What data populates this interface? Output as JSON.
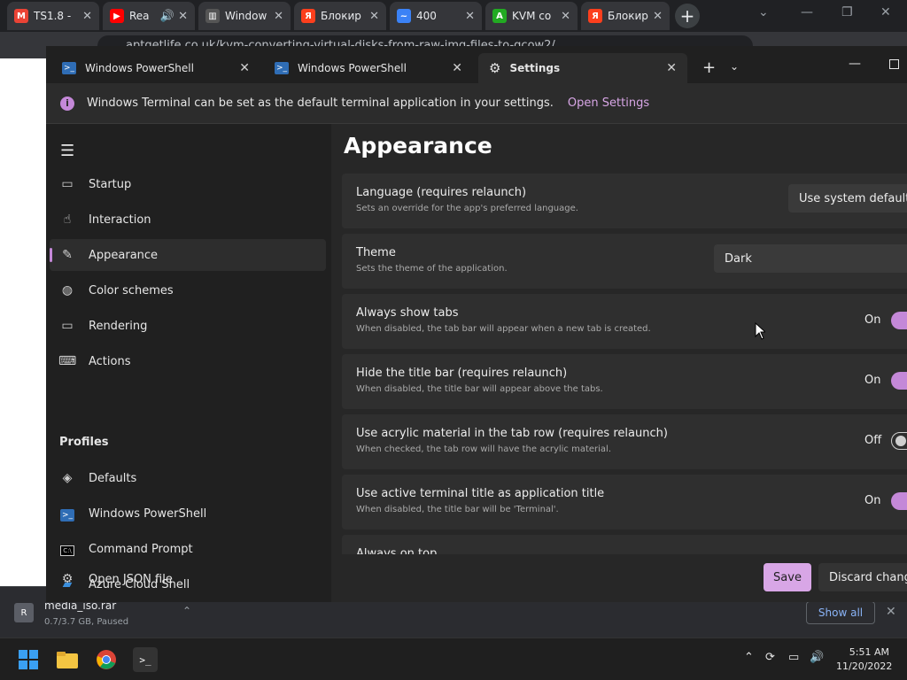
{
  "browser": {
    "tabs": [
      {
        "label": "TS1.8 - ",
        "icon": "gmail-icon",
        "color": "#ea4335"
      },
      {
        "label": "Rea",
        "icon": "youtube-icon",
        "color": "#ff0000"
      },
      {
        "label": "Window",
        "icon": "bank-icon",
        "color": "#cccccc"
      },
      {
        "label": "Блокир",
        "icon": "yandex-icon",
        "color": "#fc3f1d"
      },
      {
        "label": "400",
        "icon": "wave-icon",
        "color": "#3b82f6"
      },
      {
        "label": "KVM co",
        "icon": "a-logo-icon",
        "color": "#22aa22"
      },
      {
        "label": "Блокир",
        "icon": "yandex-icon",
        "color": "#fc3f1d"
      }
    ],
    "url": "aptgetlife.co.uk/kvm-converting-virtual-disks-from-raw-img-files-to-qcow2/"
  },
  "terminal": {
    "tabs": [
      {
        "label": "Windows PowerShell"
      },
      {
        "label": "Windows PowerShell"
      },
      {
        "label": "Settings"
      }
    ],
    "infobar": {
      "message": "Windows Terminal can be set as the default terminal application in your settings.",
      "link": "Open Settings"
    },
    "nav": {
      "items": [
        {
          "label": "Startup",
          "icon": "startup-icon"
        },
        {
          "label": "Interaction",
          "icon": "interaction-icon"
        },
        {
          "label": "Appearance",
          "icon": "brush-icon"
        },
        {
          "label": "Color schemes",
          "icon": "palette-icon"
        },
        {
          "label": "Rendering",
          "icon": "monitor-icon"
        },
        {
          "label": "Actions",
          "icon": "keyboard-icon"
        }
      ],
      "profiles_heading": "Profiles",
      "profiles": [
        {
          "label": "Defaults",
          "icon": "layers-icon"
        },
        {
          "label": "Windows PowerShell",
          "icon": "powershell-icon"
        },
        {
          "label": "Command Prompt",
          "icon": "cmd-icon"
        },
        {
          "label": "Azure Cloud Shell",
          "icon": "azure-icon"
        }
      ],
      "footer": {
        "label": "Open JSON file",
        "icon": "gear-icon"
      }
    },
    "page": {
      "title": "Appearance",
      "settings": [
        {
          "title": "Language (requires relaunch)",
          "desc": "Sets an override for the app's preferred language.",
          "control": "combo",
          "value": "Use system default"
        },
        {
          "title": "Theme",
          "desc": "Sets the theme of the application.",
          "control": "combo",
          "value": "Dark"
        },
        {
          "title": "Always show tabs",
          "desc": "When disabled, the tab bar will appear when a new tab is created.",
          "control": "toggle",
          "value": "On"
        },
        {
          "title": "Hide the title bar (requires relaunch)",
          "desc": "When disabled, the title bar will appear above the tabs.",
          "control": "toggle",
          "value": "On"
        },
        {
          "title": "Use acrylic material in the tab row (requires relaunch)",
          "desc": "When checked, the tab row will have the acrylic material.",
          "control": "toggle",
          "value": "Off"
        },
        {
          "title": "Use active terminal title as application title",
          "desc": "When disabled, the title bar will be 'Terminal'.",
          "control": "toggle",
          "value": "On"
        },
        {
          "title": "Always on top",
          "desc": "",
          "control": "toggle",
          "value": ""
        }
      ],
      "save": "Save",
      "discard": "Discard chang"
    }
  },
  "downloads": {
    "file": "media_iso.rar",
    "status": "0.7/3.7 GB, Paused",
    "show_all": "Show all"
  },
  "taskbar": {
    "time": "5:51 AM",
    "date": "11/20/2022"
  },
  "colors": {
    "accent": "#c488d8",
    "save_button": "#d8a6e6"
  }
}
